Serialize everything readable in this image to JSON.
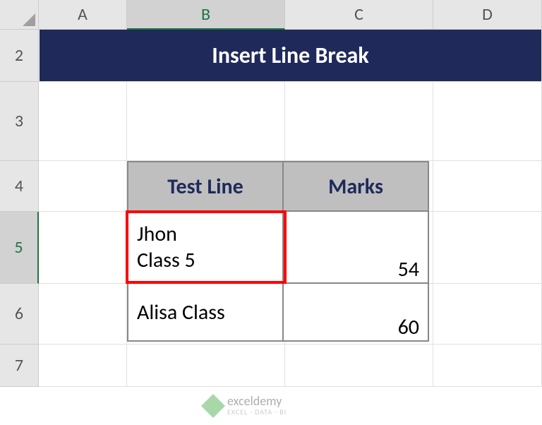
{
  "columns": {
    "A": "A",
    "B": "B",
    "C": "C",
    "D": "D"
  },
  "rows": {
    "r2": "2",
    "r3": "3",
    "r4": "4",
    "r5": "5",
    "r6": "6",
    "r7": "7"
  },
  "title": "Insert Line Break",
  "table": {
    "headers": {
      "b": "Test Line",
      "c": "Marks"
    },
    "rowsData": [
      {
        "b": "Jhon\n Class 5",
        "c": "54"
      },
      {
        "b": "Alisa Class",
        "c": "60"
      }
    ]
  },
  "watermark": {
    "name": "exceldemy",
    "tagline": "EXCEL · DATA · BI"
  },
  "active": {
    "col": "B",
    "row": "5"
  }
}
